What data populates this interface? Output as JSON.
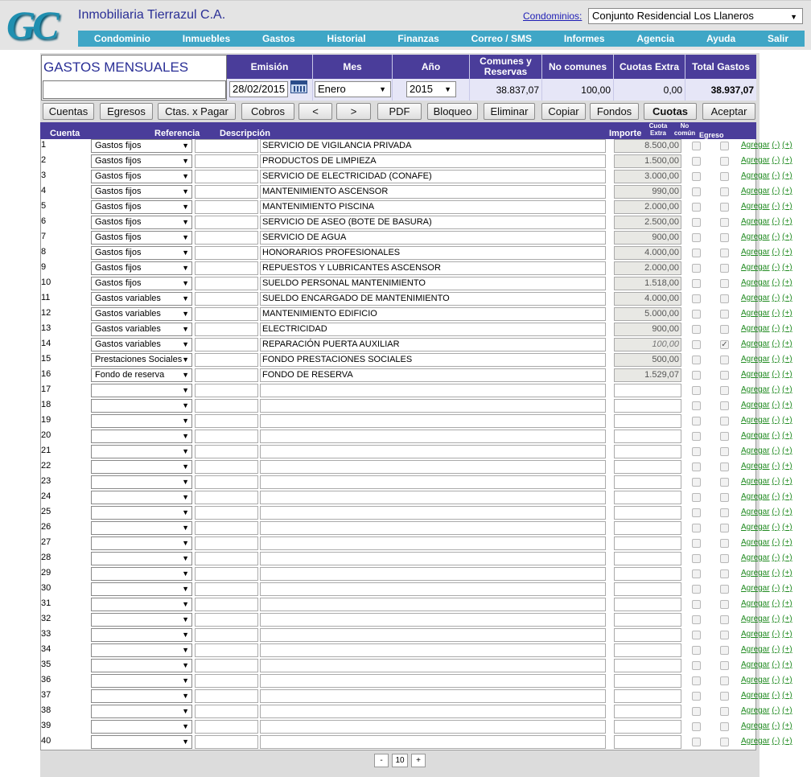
{
  "header": {
    "logo": "GC",
    "company": "Inmobiliaria Tierrazul C.A.",
    "condominios_label": "Condominios:",
    "condominio_selected": "Conjunto Residencial Los Llaneros"
  },
  "nav": [
    "Condominio",
    "Inmuebles",
    "Gastos",
    "Historial",
    "Finanzas",
    "Correo / SMS",
    "Informes",
    "Agencia",
    "Ayuda",
    "Salir"
  ],
  "summary": {
    "title": "GASTOS MENSUALES",
    "col_emision": "Emisión",
    "col_mes": "Mes",
    "col_anio": "Año",
    "col_comunes": "Comunes y Reservas",
    "col_no_comunes": "No comunes",
    "col_cuotas_extra": "Cuotas Extra",
    "col_total": "Total Gastos",
    "emision": "28/02/2015",
    "mes": "Enero",
    "anio": "2015",
    "comunes": "38.837,07",
    "no_comunes": "100,00",
    "cuotas_extra": "0,00",
    "total": "38.937,07"
  },
  "buttons": [
    "Cuentas",
    "Egresos",
    "Ctas. x Pagar",
    "Cobros",
    "<",
    ">",
    "PDF",
    "Bloqueo",
    "Eliminar",
    "Copiar",
    "Fondos",
    "Cuotas",
    "Aceptar"
  ],
  "grid": {
    "col_cuenta": "Cuenta",
    "col_referencia": "Referencia",
    "col_descripcion": "Descripción",
    "col_importe": "Importe",
    "col_cuota_extra": "Cuota Extra",
    "col_no_comun": "No común",
    "col_egreso": "Egreso",
    "link_agregar": "Agregar",
    "link_minus": "(-)",
    "link_plus": "(+)",
    "rows": [
      {
        "n": "1",
        "cuenta": "Gastos fijos",
        "descripcion": "SERVICIO DE VIGILANCIA PRIVADA",
        "importe": "8.500,00",
        "no_comun": false
      },
      {
        "n": "2",
        "cuenta": "Gastos fijos",
        "descripcion": "PRODUCTOS DE LIMPIEZA",
        "importe": "1.500,00",
        "no_comun": false
      },
      {
        "n": "3",
        "cuenta": "Gastos fijos",
        "descripcion": "SERVICIO DE ELECTRICIDAD (CONAFE)",
        "importe": "3.000,00",
        "no_comun": false
      },
      {
        "n": "4",
        "cuenta": "Gastos fijos",
        "descripcion": "MANTENIMIENTO ASCENSOR",
        "importe": "990,00",
        "no_comun": false
      },
      {
        "n": "5",
        "cuenta": "Gastos fijos",
        "descripcion": "MANTENIMIENTO PISCINA",
        "importe": "2.000,00",
        "no_comun": false
      },
      {
        "n": "6",
        "cuenta": "Gastos fijos",
        "descripcion": "SERVICIO DE ASEO (BOTE DE BASURA)",
        "importe": "2.500,00",
        "no_comun": false
      },
      {
        "n": "7",
        "cuenta": "Gastos fijos",
        "descripcion": "SERVICIO DE AGUA",
        "importe": "900,00",
        "no_comun": false
      },
      {
        "n": "8",
        "cuenta": "Gastos fijos",
        "descripcion": "HONORARIOS PROFESIONALES",
        "importe": "4.000,00",
        "no_comun": false
      },
      {
        "n": "9",
        "cuenta": "Gastos fijos",
        "descripcion": "REPUESTOS Y LUBRICANTES ASCENSOR",
        "importe": "2.000,00",
        "no_comun": false
      },
      {
        "n": "10",
        "cuenta": "Gastos fijos",
        "descripcion": "SUELDO PERSONAL MANTENIMIENTO",
        "importe": "1.518,00",
        "no_comun": false
      },
      {
        "n": "11",
        "cuenta": "Gastos variables",
        "descripcion": "SUELDO ENCARGADO DE MANTENIMIENTO",
        "importe": "4.000,00",
        "no_comun": false
      },
      {
        "n": "12",
        "cuenta": "Gastos variables",
        "descripcion": "MANTENIMIENTO EDIFICIO",
        "importe": "5.000,00",
        "no_comun": false
      },
      {
        "n": "13",
        "cuenta": "Gastos variables",
        "descripcion": "ELECTRICIDAD",
        "importe": "900,00",
        "no_comun": false
      },
      {
        "n": "14",
        "cuenta": "Gastos variables",
        "descripcion": "REPARACIÓN PUERTA AUXILIAR",
        "importe": "100,00",
        "no_comun": true
      },
      {
        "n": "15",
        "cuenta": "Prestaciones Sociales",
        "descripcion": "FONDO PRESTACIONES SOCIALES",
        "importe": "500,00",
        "no_comun": false
      },
      {
        "n": "16",
        "cuenta": "Fondo de reserva",
        "descripcion": "FONDO DE RESERVA",
        "importe": "1.529,07",
        "no_comun": false
      },
      {
        "n": "17",
        "cuenta": "",
        "descripcion": "",
        "importe": "",
        "no_comun": false
      },
      {
        "n": "18",
        "cuenta": "",
        "descripcion": "",
        "importe": "",
        "no_comun": false
      },
      {
        "n": "19",
        "cuenta": "",
        "descripcion": "",
        "importe": "",
        "no_comun": false
      },
      {
        "n": "20",
        "cuenta": "",
        "descripcion": "",
        "importe": "",
        "no_comun": false
      },
      {
        "n": "21",
        "cuenta": "",
        "descripcion": "",
        "importe": "",
        "no_comun": false
      },
      {
        "n": "22",
        "cuenta": "",
        "descripcion": "",
        "importe": "",
        "no_comun": false
      },
      {
        "n": "23",
        "cuenta": "",
        "descripcion": "",
        "importe": "",
        "no_comun": false
      },
      {
        "n": "24",
        "cuenta": "",
        "descripcion": "",
        "importe": "",
        "no_comun": false
      },
      {
        "n": "25",
        "cuenta": "",
        "descripcion": "",
        "importe": "",
        "no_comun": false
      },
      {
        "n": "26",
        "cuenta": "",
        "descripcion": "",
        "importe": "",
        "no_comun": false
      },
      {
        "n": "27",
        "cuenta": "",
        "descripcion": "",
        "importe": "",
        "no_comun": false
      },
      {
        "n": "28",
        "cuenta": "",
        "descripcion": "",
        "importe": "",
        "no_comun": false
      },
      {
        "n": "29",
        "cuenta": "",
        "descripcion": "",
        "importe": "",
        "no_comun": false
      },
      {
        "n": "30",
        "cuenta": "",
        "descripcion": "",
        "importe": "",
        "no_comun": false
      },
      {
        "n": "31",
        "cuenta": "",
        "descripcion": "",
        "importe": "",
        "no_comun": false
      },
      {
        "n": "32",
        "cuenta": "",
        "descripcion": "",
        "importe": "",
        "no_comun": false
      },
      {
        "n": "33",
        "cuenta": "",
        "descripcion": "",
        "importe": "",
        "no_comun": false
      },
      {
        "n": "34",
        "cuenta": "",
        "descripcion": "",
        "importe": "",
        "no_comun": false
      },
      {
        "n": "35",
        "cuenta": "",
        "descripcion": "",
        "importe": "",
        "no_comun": false
      },
      {
        "n": "36",
        "cuenta": "",
        "descripcion": "",
        "importe": "",
        "no_comun": false
      },
      {
        "n": "37",
        "cuenta": "",
        "descripcion": "",
        "importe": "",
        "no_comun": false
      },
      {
        "n": "38",
        "cuenta": "",
        "descripcion": "",
        "importe": "",
        "no_comun": false
      },
      {
        "n": "39",
        "cuenta": "",
        "descripcion": "",
        "importe": "",
        "no_comun": false
      },
      {
        "n": "40",
        "cuenta": "",
        "descripcion": "",
        "importe": "",
        "no_comun": false
      }
    ]
  },
  "pager": {
    "minus": "-",
    "count": "10",
    "plus": "+"
  }
}
